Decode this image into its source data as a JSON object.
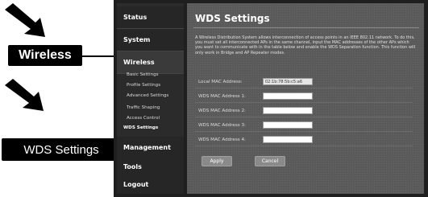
{
  "callouts": {
    "wireless": "Wireless",
    "wds_settings": "WDS Settings"
  },
  "sidebar": {
    "items": [
      {
        "label": "Status"
      },
      {
        "label": "System"
      },
      {
        "label": "Wireless"
      },
      {
        "label": "Management"
      },
      {
        "label": "Tools"
      },
      {
        "label": "Logout"
      }
    ],
    "wireless_sub": [
      {
        "label": "Basic Settings"
      },
      {
        "label": "Profile Settings"
      },
      {
        "label": "Advanced Settings"
      },
      {
        "label": "Traffic Shaping"
      },
      {
        "label": "Access Control"
      },
      {
        "label": "WDS Settings"
      }
    ]
  },
  "content": {
    "title": "WDS Settings",
    "description": "A Wireless Distribution System allows interconnection of access points in an IEEE 802.11 network. To do this, you must set all interconnected APs in the same channel, input the MAC addresses of the other APs which you want to communicate with in the table below and enable the WDS Separation function. This function will only work in Bridge and AP Repeater modes.",
    "fields": [
      {
        "label": "Local MAC Address:",
        "value": "02:1b:78:5b:c5:a6",
        "readonly": true
      },
      {
        "label": "WDS MAC Address 1:",
        "value": ""
      },
      {
        "label": "WDS MAC Address 2:",
        "value": ""
      },
      {
        "label": "WDS MAC Address 3:",
        "value": ""
      },
      {
        "label": "WDS MAC Address 4:",
        "value": ""
      }
    ],
    "apply_label": "Apply",
    "cancel_label": "Cancel"
  }
}
